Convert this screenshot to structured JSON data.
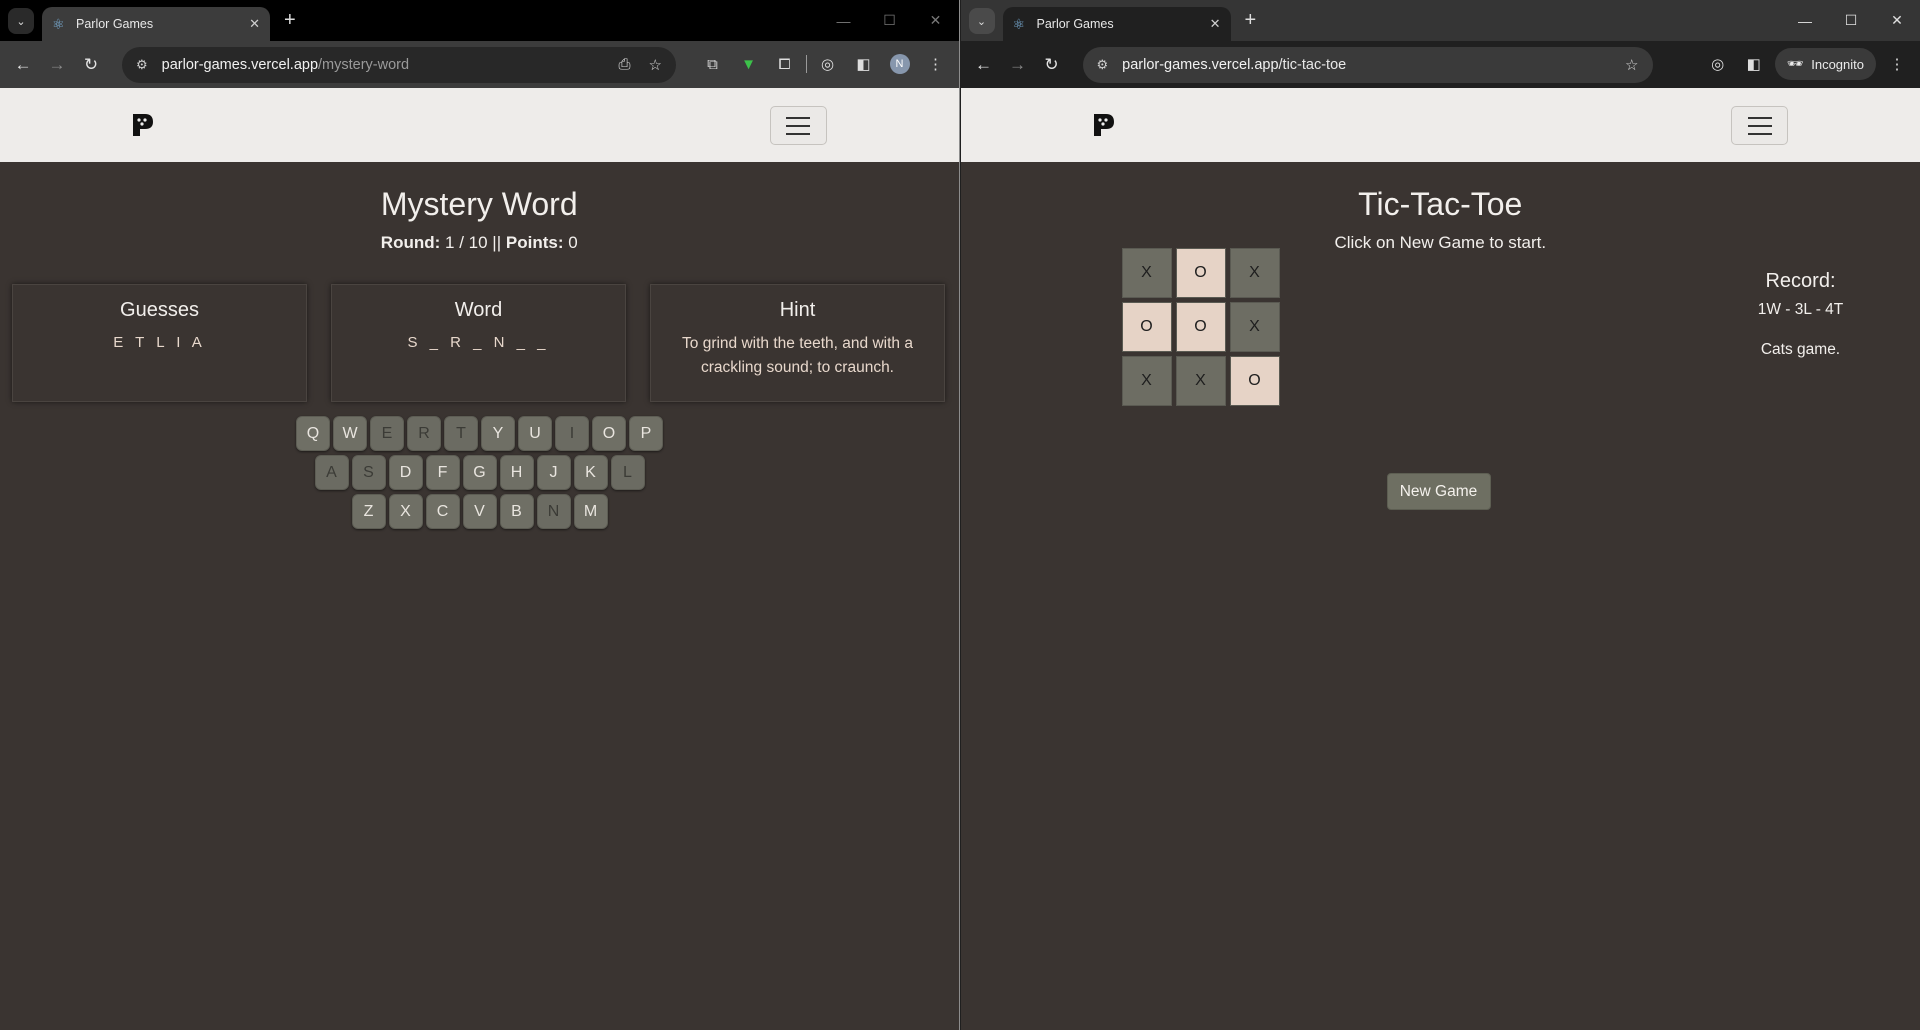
{
  "left": {
    "tab_title": "Parlor Games",
    "url_host": "parlor-games.vercel.app",
    "url_path": "/mystery-word",
    "avatar_initial": "N",
    "game": {
      "title": "Mystery Word",
      "round_label": "Round:",
      "round_value": "1 / 10",
      "separator": "||",
      "points_label": "Points:",
      "points_value": "0",
      "guesses_title": "Guesses",
      "guesses_value": "E T L I A",
      "word_title": "Word",
      "word_value": "S _ R _ N _ _",
      "hint_title": "Hint",
      "hint_value": "To grind with the teeth, and with a crackling sound; to craunch."
    },
    "keyboard": {
      "row1": [
        {
          "k": "Q",
          "used": false
        },
        {
          "k": "W",
          "used": false
        },
        {
          "k": "E",
          "used": true
        },
        {
          "k": "R",
          "used": true
        },
        {
          "k": "T",
          "used": true
        },
        {
          "k": "Y",
          "used": false
        },
        {
          "k": "U",
          "used": false
        },
        {
          "k": "I",
          "used": true
        },
        {
          "k": "O",
          "used": false
        },
        {
          "k": "P",
          "used": false
        }
      ],
      "row2": [
        {
          "k": "A",
          "used": true
        },
        {
          "k": "S",
          "used": true
        },
        {
          "k": "D",
          "used": false
        },
        {
          "k": "F",
          "used": false
        },
        {
          "k": "G",
          "used": false
        },
        {
          "k": "H",
          "used": false
        },
        {
          "k": "J",
          "used": false
        },
        {
          "k": "K",
          "used": false
        },
        {
          "k": "L",
          "used": true
        }
      ],
      "row3": [
        {
          "k": "Z",
          "used": false
        },
        {
          "k": "X",
          "used": false
        },
        {
          "k": "C",
          "used": false
        },
        {
          "k": "V",
          "used": false
        },
        {
          "k": "B",
          "used": false
        },
        {
          "k": "N",
          "used": true
        },
        {
          "k": "M",
          "used": false
        }
      ]
    }
  },
  "right": {
    "tab_title": "Parlor Games",
    "url_host": "parlor-games.vercel.app",
    "url_path": "/tic-tac-toe",
    "incognito_label": "Incognito",
    "game": {
      "title": "Tic-Tac-Toe",
      "subtitle": "Click on New Game to start.",
      "record_title": "Record:",
      "record_value": "1W - 3L - 4T",
      "status": "Cats game.",
      "new_game_label": "New Game",
      "board": [
        "X",
        "O",
        "X",
        "O",
        "O",
        "X",
        "X",
        "X",
        "O"
      ]
    }
  },
  "colors": {
    "page_bg": "#3a3431",
    "header_bg": "#eeecea",
    "cell_x": "#6d6d63",
    "cell_o": "#e6d3c6",
    "button": "#6e6f62"
  }
}
